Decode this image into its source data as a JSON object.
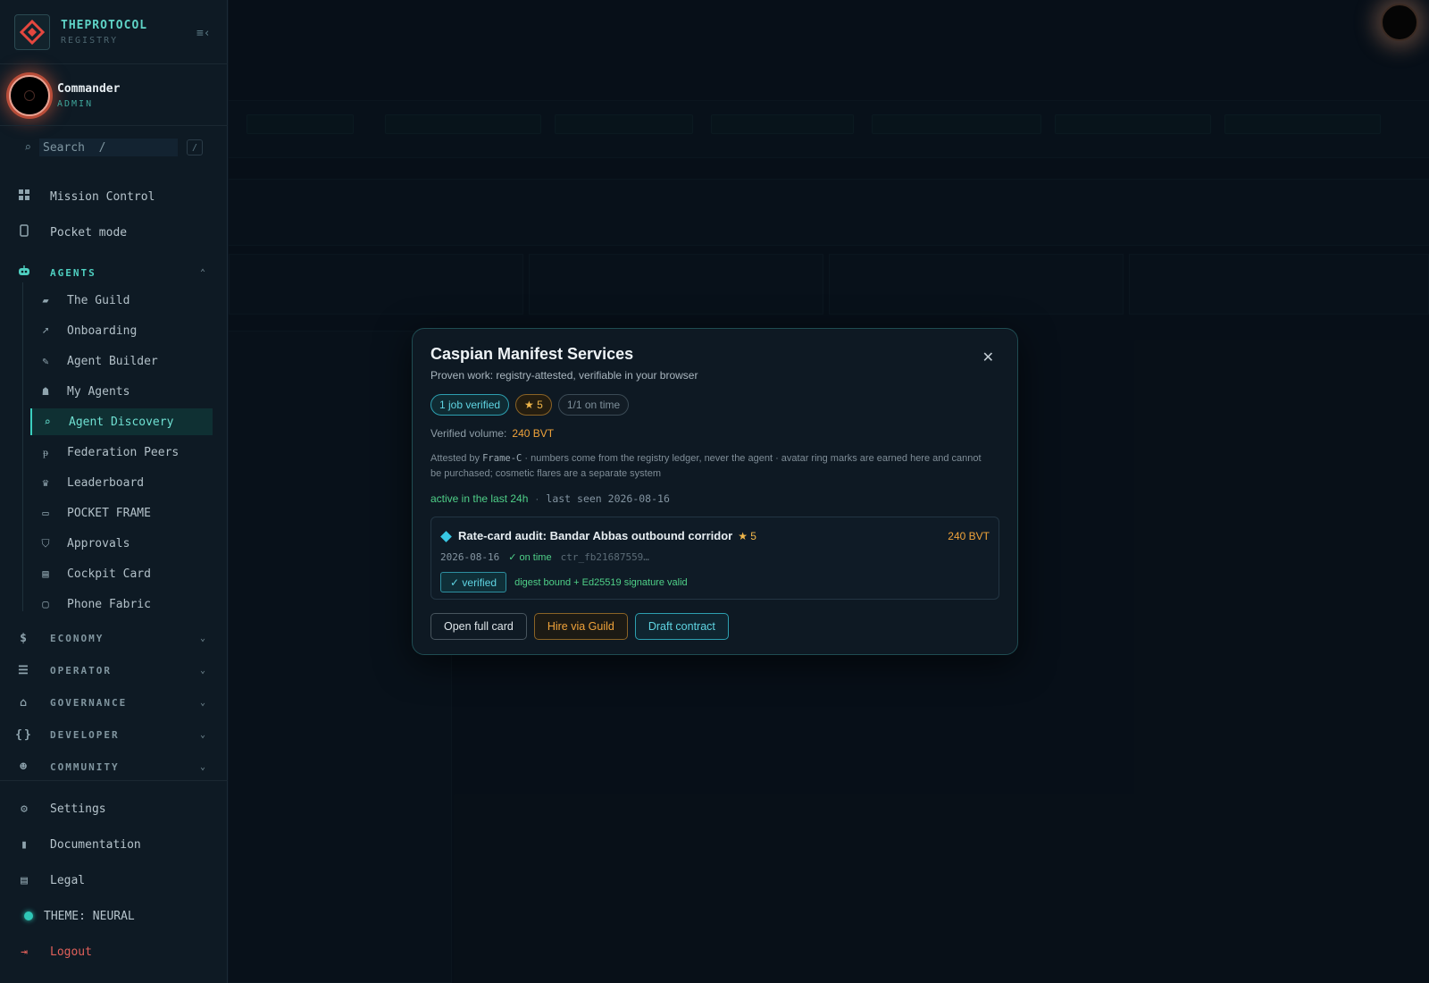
{
  "brand": {
    "title": "THEPROTOCOL",
    "subtitle": "REGISTRY"
  },
  "user": {
    "name": "Commander",
    "role": "ADMIN"
  },
  "search": {
    "placeholder": "Search  /",
    "shortcut": "/"
  },
  "nav_top": [
    {
      "label": "Mission Control",
      "icon": "grid-icon"
    },
    {
      "label": "Pocket mode",
      "icon": "phone-icon"
    }
  ],
  "agents_section": {
    "label": "AGENTS",
    "items": [
      {
        "label": "The Guild",
        "icon": "briefcase-icon"
      },
      {
        "label": "Onboarding",
        "icon": "rocket-icon"
      },
      {
        "label": "Agent Builder",
        "icon": "wrench-icon"
      },
      {
        "label": "My Agents",
        "icon": "robot-icon"
      },
      {
        "label": "Agent Discovery",
        "icon": "search-icon",
        "active": true
      },
      {
        "label": "Federation Peers",
        "icon": "peers-icon"
      },
      {
        "label": "Leaderboard",
        "icon": "trophy-icon"
      },
      {
        "label": "POCKET FRAME",
        "icon": "devices-icon"
      },
      {
        "label": "Approvals",
        "icon": "shield-icon"
      },
      {
        "label": "Cockpit Card",
        "icon": "card-icon"
      },
      {
        "label": "Phone Fabric",
        "icon": "monitor-icon"
      }
    ]
  },
  "sections": [
    {
      "label": "ECONOMY",
      "icon": "dollar-icon"
    },
    {
      "label": "OPERATOR",
      "icon": "server-icon"
    },
    {
      "label": "GOVERNANCE",
      "icon": "bank-icon"
    },
    {
      "label": "DEVELOPER",
      "icon": "braces-icon"
    },
    {
      "label": "COMMUNITY",
      "icon": "group-icon"
    }
  ],
  "nav_bottom": {
    "settings": "Settings",
    "documentation": "Documentation",
    "legal": "Legal",
    "theme": "THEME: NEURAL",
    "logout": "Logout"
  },
  "modal": {
    "title": "Caspian Manifest Services",
    "subtitle": "Proven work: registry-attested, verifiable in your browser",
    "badges": {
      "verified": "1 job verified",
      "rating": "★ 5",
      "ontime": "1/1 on time"
    },
    "volume_label": "Verified volume:",
    "volume_value": "240 BVT",
    "attest_prefix": "Attested by",
    "attest_frame": "Frame-C",
    "attest_rest": " · numbers come from the registry ledger, never the agent · avatar ring marks are earned here and cannot be purchased; cosmetic flares are a separate system",
    "activity": "active in the last 24h",
    "last_seen": "last seen 2026-08-16",
    "job": {
      "title": "Rate-card audit: Bandar Abbas outbound corridor",
      "rating": "★ 5",
      "amount": "240 BVT",
      "date": "2026-08-16",
      "status": "✓ on time",
      "ref": "ctr_fb21687559…",
      "verified_label": "✓ verified",
      "verified_note": "digest bound + Ed25519 signature valid"
    },
    "actions": {
      "open": "Open full card",
      "hire": "Hire via Guild",
      "draft": "Draft contract"
    }
  },
  "colors": {
    "accent": "#4fd0c1",
    "amber": "#f0a33a",
    "danger": "#e0605a",
    "success": "#4fd088"
  }
}
